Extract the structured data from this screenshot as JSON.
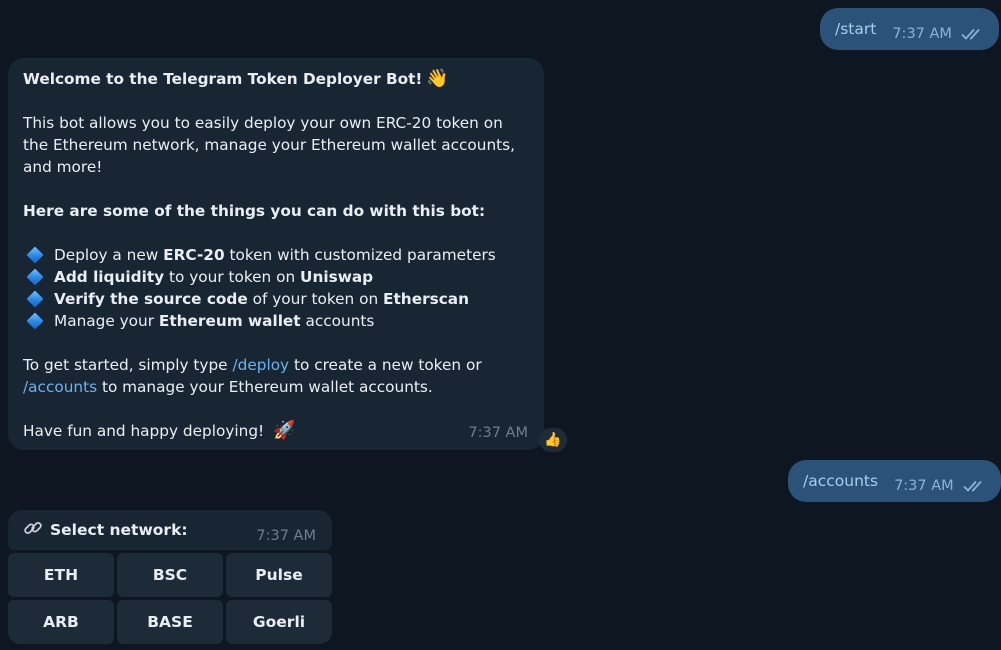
{
  "messages": {
    "start": {
      "text": "/start",
      "time": "7:37 AM"
    },
    "welcome": {
      "title": "Welcome to the Telegram Token Deployer Bot!",
      "title_emoji": "👋",
      "intro": "This bot allows you to easily deploy your own ERC-20 token on the Ethereum network, manage your Ethereum wallet accounts, and more!",
      "heading": "Here are some of the things you can do with this bot:",
      "features": [
        {
          "pre": "Deploy a new ",
          "bold1": "ERC-20",
          "mid": " token with customized parameters",
          "bold2": "",
          "post": ""
        },
        {
          "pre": "",
          "bold1": "Add liquidity",
          "mid": " to your token on ",
          "bold2": "Uniswap",
          "post": ""
        },
        {
          "pre": "",
          "bold1": "Verify the source code",
          "mid": " of your token on ",
          "bold2": "Etherscan",
          "post": ""
        },
        {
          "pre": "Manage your ",
          "bold1": "Ethereum wallet",
          "mid": " accounts",
          "bold2": "",
          "post": ""
        }
      ],
      "start_pre": "To get started, simply type ",
      "deploy_cmd": "/deploy",
      "start_mid": " to create a new token or",
      "accounts_cmd": "/accounts",
      "start_post": " to manage your Ethereum wallet accounts.",
      "closing": "Have fun and happy deploying!",
      "closing_emoji": "🚀",
      "time": "7:37 AM",
      "reaction": "👍"
    },
    "accounts": {
      "text": "/accounts",
      "time": "7:37 AM"
    },
    "network": {
      "title": "Select network:",
      "time": "7:37 AM",
      "buttons": [
        "ETH",
        "BSC",
        "Pulse",
        "ARB",
        "BASE",
        "Goerli"
      ]
    }
  },
  "colors": {
    "background": "#0e1621",
    "outgoing_bubble": "#2b5278",
    "incoming_bubble": "#182533",
    "link": "#6ab2f2"
  },
  "icons": {
    "read_status": "double-check-icon",
    "link": "link-icon",
    "feature_bullet": "blue-diamond-icon"
  }
}
